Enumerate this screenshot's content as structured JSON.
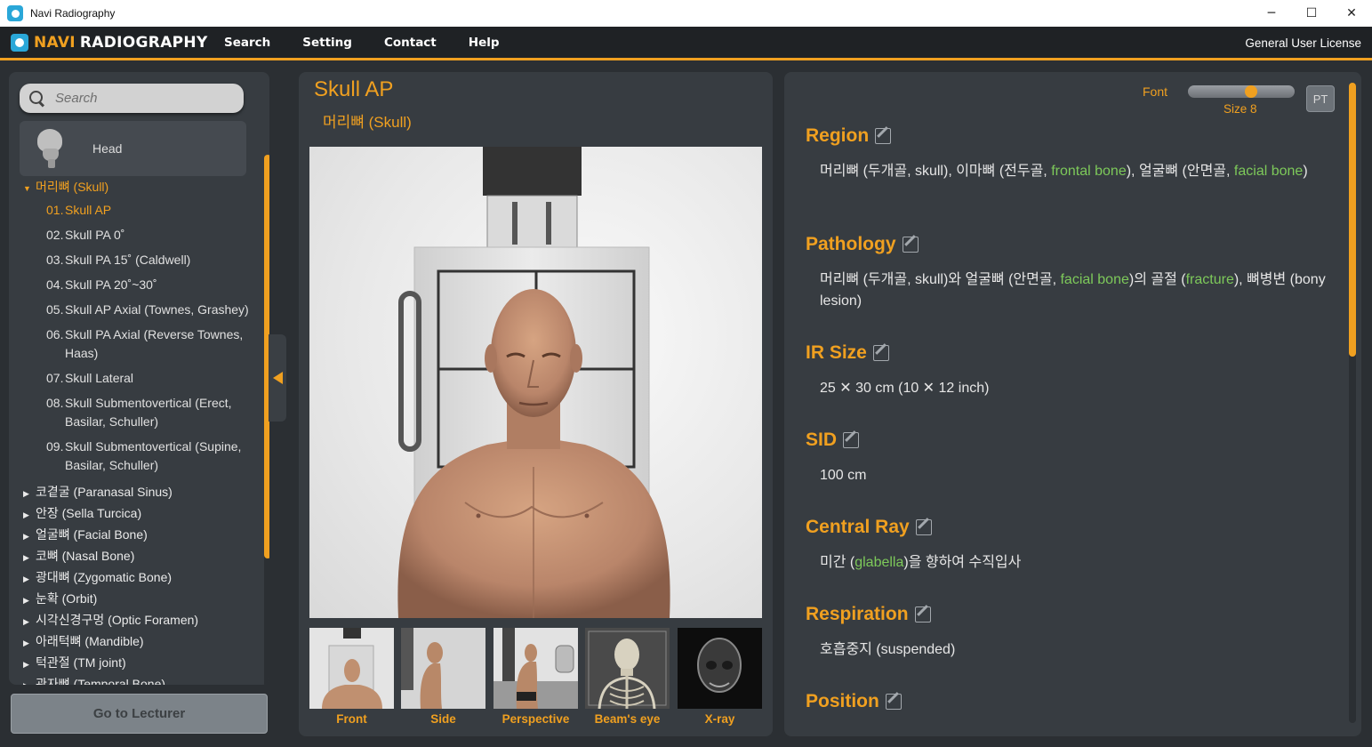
{
  "window": {
    "title": "Navi Radiography",
    "minimize": "─",
    "maximize": "☐",
    "close": "✕"
  },
  "menubar": {
    "brand_part1": "NAVI",
    "brand_part2": "RADIOGRAPHY",
    "items": [
      "Search",
      "Setting",
      "Contact",
      "Help"
    ],
    "license": "General User License"
  },
  "sidebar": {
    "search_placeholder": "Search",
    "region": "Head",
    "open_category": "머리뼈 (Skull)",
    "items": [
      {
        "num": "01.",
        "label": "Skull AP"
      },
      {
        "num": "02.",
        "label": "Skull PA 0˚"
      },
      {
        "num": "03.",
        "label": "Skull PA 15˚ (Caldwell)"
      },
      {
        "num": "04.",
        "label": "Skull PA 20˚~30˚"
      },
      {
        "num": "05.",
        "label": "Skull AP Axial (Townes, Grashey)"
      },
      {
        "num": "06.",
        "label": "Skull PA Axial (Reverse Townes, Haas)"
      },
      {
        "num": "07.",
        "label": "Skull Lateral"
      },
      {
        "num": "08.",
        "label": "Skull Submentovertical (Erect, Basilar, Schuller)"
      },
      {
        "num": "09.",
        "label": "Skull Submentovertical (Supine, Basilar, Schuller)"
      }
    ],
    "categories": [
      "코곁굴 (Paranasal Sinus)",
      "안장 (Sella Turcica)",
      "얼굴뼈 (Facial Bone)",
      "코뼈 (Nasal Bone)",
      "광대뼈 (Zygomatic Bone)",
      "눈확 (Orbit)",
      "시각신경구멍 (Optic Foramen)",
      "아래턱뼈 (Mandible)",
      "턱관절 (TM joint)",
      "관자뼈 (Temporal Bone)"
    ],
    "goto_button": "Go to Lecturer"
  },
  "viewer": {
    "title": "Skull AP",
    "subtitle": "머리뼈 (Skull)",
    "thumbnails": [
      "Front",
      "Side",
      "Perspective",
      "Beam's eye",
      "X-ray"
    ]
  },
  "details": {
    "font_label": "Font",
    "font_size_label": "Size 8",
    "font_size_level": 0.6,
    "pt_button": "PT",
    "sections": {
      "region": {
        "title": "Region",
        "t1": "머리뼈 (두개골, skull), 이마뼈 (전두골, ",
        "h1": "frontal bone",
        "t2": "), 얼굴뼈 (안면골, ",
        "h2": "facial bone",
        "t3": ")"
      },
      "pathology": {
        "title": "Pathology",
        "t1": "머리뼈 (두개골, skull)와 얼굴뼈 (안면골, ",
        "h1": "facial bone",
        "t2": ")의 골절 (",
        "h2": "fracture",
        "t3": "), 뼈병변 (bony lesion)"
      },
      "ir_size": {
        "title": "IR Size",
        "body": "25 ✕ 30 cm (10 ✕ 12 inch)"
      },
      "sid": {
        "title": "SID",
        "body": "100 cm"
      },
      "central_ray": {
        "title": "Central Ray",
        "t1": "미간 (",
        "h1": "glabella",
        "t2": ")을 향하여 수직입사"
      },
      "respiration": {
        "title": "Respiration",
        "body": "호흡중지 (suspended)"
      },
      "position": {
        "title": "Position"
      }
    }
  },
  "colors": {
    "accent": "#f0a020",
    "highlight": "#7dc95a",
    "panel": "#373c41",
    "background": "#2b2f33"
  }
}
